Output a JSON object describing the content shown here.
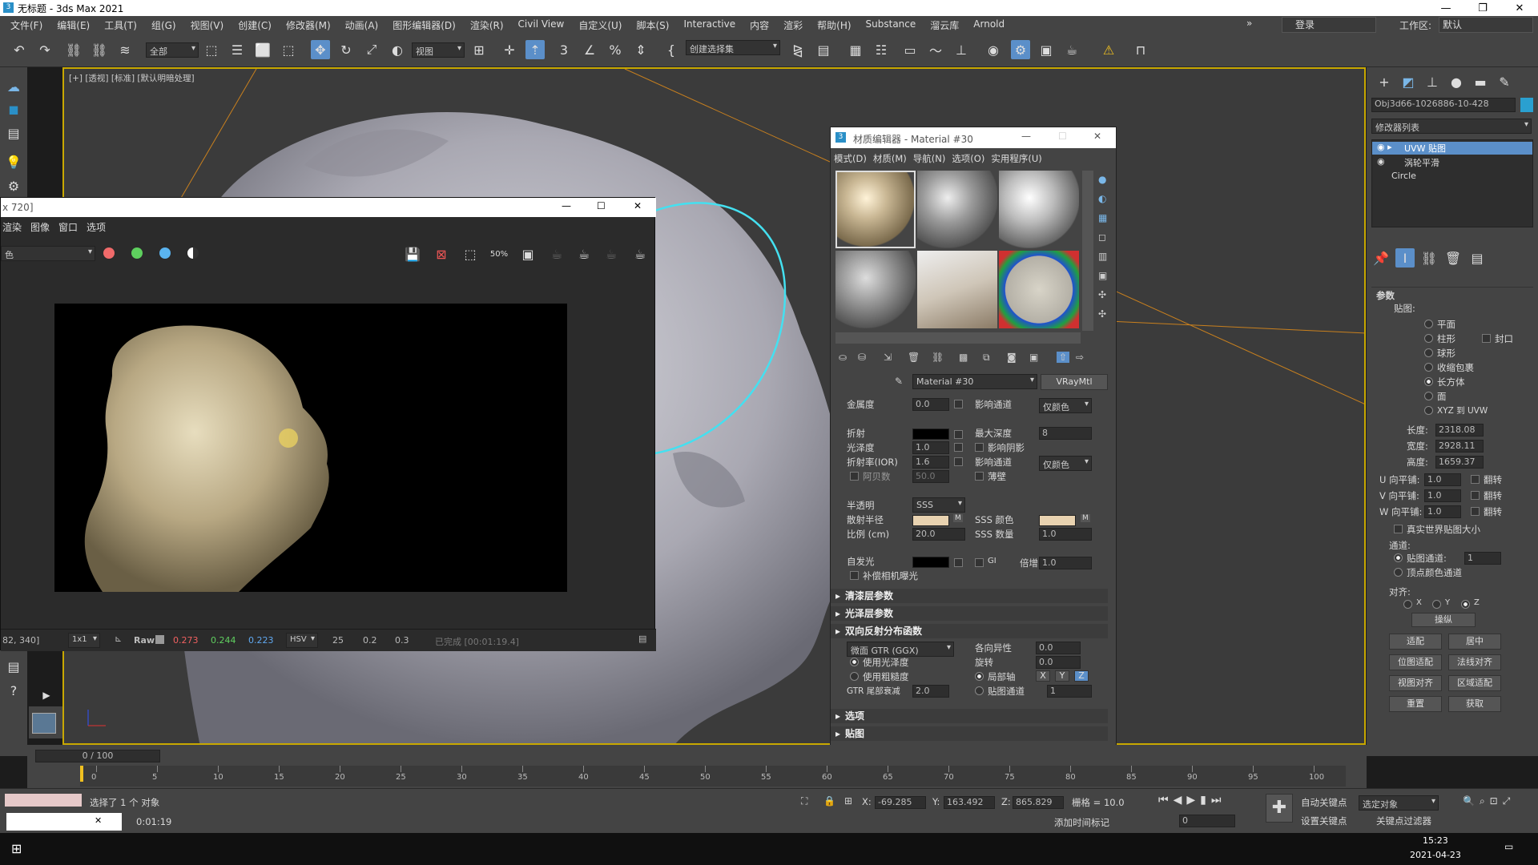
{
  "window": {
    "title": "无标题 - 3ds Max 2021"
  },
  "menu": [
    "文件(F)",
    "编辑(E)",
    "工具(T)",
    "组(G)",
    "视图(V)",
    "创建(C)",
    "修改器(M)",
    "动画(A)",
    "图形编辑器(D)",
    "渲染(R)",
    "Civil View",
    "自定义(U)",
    "脚本(S)",
    "Interactive",
    "内容",
    "渲彩",
    "帮助(H)",
    "Substance",
    "溜云库",
    "Arnold"
  ],
  "menu_extra": {
    "more": "»",
    "login": "登录",
    "workspace_label": "工作区:",
    "workspace_value": "默认"
  },
  "toolbar": {
    "selection_filter": "全部",
    "ref_coord": "视图",
    "named_set": "创建选择集"
  },
  "viewport": {
    "label": "[+] [透视] [标准] [默认明暗处理]"
  },
  "render_window": {
    "title": "x 720]",
    "menu": [
      "渲染",
      "图像",
      "窗口",
      "选项"
    ],
    "channel": "色",
    "status": {
      "coords": "82, 340]",
      "zoom": "1x1",
      "raw": "Raw",
      "r": "0.273",
      "g": "0.244",
      "b": "0.223",
      "mode": "HSV",
      "h": "25",
      "s": "0.2",
      "v": "0.3",
      "done": "已完成 [00:01:19.4]"
    },
    "zoom_icon_text": "50%"
  },
  "material_editor": {
    "title": "材质编辑器 - Material #30",
    "menu": [
      "模式(D)",
      "材质(M)",
      "导航(N)",
      "选项(O)",
      "实用程序(U)"
    ],
    "material_name": "Material #30",
    "material_type": "VRayMtl",
    "params": {
      "metal_label": "金属度",
      "metal_val": "0.0",
      "affect_ch1": "影响通道",
      "affect_ch1_val": "仅颜色",
      "refract": "折射",
      "max_depth": "最大深度",
      "max_depth_val": "8",
      "gloss": "光泽度",
      "gloss_val": "1.0",
      "affect_shadow": "影响阴影",
      "ior": "折射率(IOR)",
      "ior_val": "1.6",
      "affect_ch2": "影响通道",
      "affect_ch2_val": "仅颜色",
      "abbe": "阿贝数",
      "abbe_val": "50.0",
      "thin": "薄壁",
      "translucency": "半透明",
      "translucency_val": "SSS",
      "scatter_radius": "散射半径",
      "sss_color": "SSS 颜色",
      "scale": "比例 (cm)",
      "scale_val": "20.0",
      "sss_amount": "SSS 数量",
      "sss_amount_val": "1.0",
      "selfillum": "自发光",
      "gi": "GI",
      "multiplier": "倍增",
      "multiplier_val": "1.0",
      "comp_cam": "补偿相机曝光",
      "m": "M"
    },
    "sections": [
      "清漆层参数",
      "光泽层参数",
      "双向反射分布函数",
      "选项",
      "贴图"
    ],
    "brdf": {
      "type": "微面 GTR (GGX)",
      "use_gloss": "使用光泽度",
      "use_rough": "使用粗糙度",
      "gtr_tail": "GTR 尾部衰减",
      "gtr_val": "2.0",
      "aniso": "各向异性",
      "aniso_val": "0.0",
      "rotation": "旋转",
      "rotation_val": "0.0",
      "local_axis": "局部轴",
      "map_channel": "贴图通道",
      "map_channel_val": "1",
      "x": "X",
      "y": "Y",
      "z": "Z"
    }
  },
  "command_panel": {
    "object_name": "Obj3d66-1026886-10-428",
    "modifier_list": "修改器列表",
    "stack": [
      "UVW 贴图",
      "涡轮平滑",
      "Circle"
    ],
    "params_title": "参数",
    "mapping": "贴图:",
    "options": [
      "平面",
      "柱形",
      "球形",
      "收缩包裹",
      "长方体",
      "面",
      "XYZ 到 UVW"
    ],
    "cap": "封口",
    "length": "长度:",
    "length_val": "2318.08",
    "width": "宽度:",
    "width_val": "2928.11",
    "height": "高度:",
    "height_val": "1659.37",
    "u_tile": "U 向平铺:",
    "v_tile": "V 向平铺:",
    "w_tile": "W 向平铺:",
    "tile_val": "1.0",
    "flip": "翻转",
    "real_world": "真实世界贴图大小",
    "channel_title": "通道:",
    "map_ch": "贴图通道:",
    "map_ch_val": "1",
    "vertex_ch": "顶点颜色通道",
    "align_title": "对齐:",
    "ax": "X",
    "ay": "Y",
    "az": "Z",
    "manip": "操纵",
    "btns": [
      "适配",
      "居中",
      "位图适配",
      "法线对齐",
      "视图对齐",
      "区域适配",
      "重置",
      "获取"
    ]
  },
  "timeline": {
    "frame": "0 / 100",
    "ticks": [
      "0",
      "5",
      "10",
      "15",
      "20",
      "25",
      "30",
      "35",
      "40",
      "45",
      "50",
      "55",
      "60",
      "65",
      "70",
      "75",
      "80",
      "85",
      "90",
      "95",
      "100"
    ]
  },
  "status": {
    "selected": "选择了 1 个 对象",
    "time": "0:01:19",
    "x_label": "X:",
    "x": "-69.285",
    "y_label": "Y:",
    "y": "163.492",
    "z_label": "Z:",
    "z": "865.829",
    "grid": "栅格 = 10.0",
    "add_time_tag": "添加时间标记",
    "auto_key": "自动关键点",
    "set_key": "设置关键点",
    "selected_obj": "选定对象",
    "key_filter": "关键点过滤器",
    "frame_val": "0"
  },
  "taskbar": {
    "time": "15:23",
    "date": "2021-04-23"
  }
}
